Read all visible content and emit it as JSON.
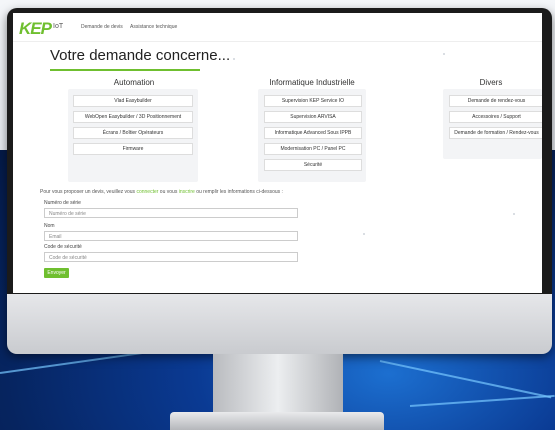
{
  "brand": {
    "logo": "KEP",
    "logo_suffix": "IoT",
    "accent": "#6fbf2f"
  },
  "nav": {
    "item1": "Demande de devis",
    "item2": "Assistance technique"
  },
  "heading": "Votre demande concerne...",
  "columns": [
    {
      "title": "Automation",
      "options": [
        "Vlad Easybuilder",
        "WebOpen Easybuilder / 3D Positionnement",
        "Écrans / Boîtier Opérateurs",
        "Firmware"
      ]
    },
    {
      "title": "Informatique Industrielle",
      "options": [
        "Supervision KEP Service IO",
        "Supervision ARVISA",
        "Informatique Advanced Sous IPPB",
        "Modernisation PC / Panel PC",
        "Sécurité"
      ]
    },
    {
      "title": "Divers",
      "options": [
        "Demande de rendez-vous",
        "Accessoires / Support",
        "Demande de formation / Rendez-vous"
      ]
    }
  ],
  "form": {
    "intro_prefix": "Pour vous proposer un devis, veuillez vous ",
    "intro_link1": "connecter",
    "intro_mid": " ou vous ",
    "intro_link2": "inscrire",
    "intro_suffix": " ou remplir les informations ci-dessous :",
    "fields": [
      {
        "label": "Numéro de série",
        "placeholder": "Numéro de série"
      },
      {
        "label": "Nom",
        "placeholder": "Email"
      },
      {
        "label": "Code de sécurité",
        "placeholder": "Code de sécurité"
      }
    ],
    "submit": "Envoyer"
  }
}
